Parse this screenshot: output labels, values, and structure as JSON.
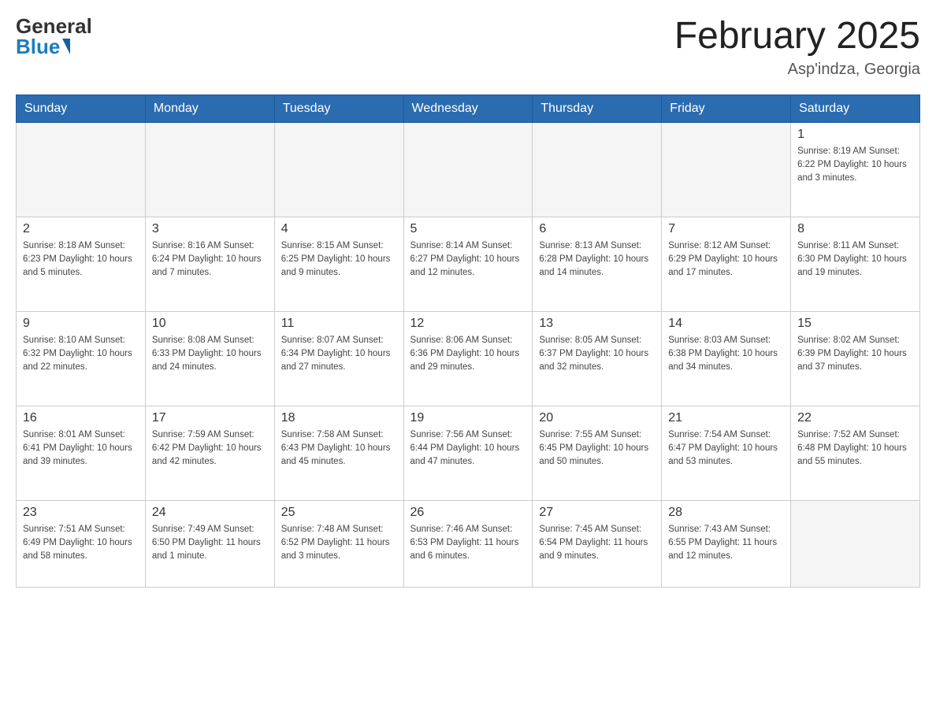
{
  "header": {
    "logo_general": "General",
    "logo_blue": "Blue",
    "month_title": "February 2025",
    "location": "Asp'indza, Georgia"
  },
  "calendar": {
    "days_of_week": [
      "Sunday",
      "Monday",
      "Tuesday",
      "Wednesday",
      "Thursday",
      "Friday",
      "Saturday"
    ],
    "weeks": [
      [
        {
          "day": "",
          "info": "",
          "empty": true
        },
        {
          "day": "",
          "info": "",
          "empty": true
        },
        {
          "day": "",
          "info": "",
          "empty": true
        },
        {
          "day": "",
          "info": "",
          "empty": true
        },
        {
          "day": "",
          "info": "",
          "empty": true
        },
        {
          "day": "",
          "info": "",
          "empty": true
        },
        {
          "day": "1",
          "info": "Sunrise: 8:19 AM\nSunset: 6:22 PM\nDaylight: 10 hours\nand 3 minutes.",
          "empty": false
        }
      ],
      [
        {
          "day": "2",
          "info": "Sunrise: 8:18 AM\nSunset: 6:23 PM\nDaylight: 10 hours\nand 5 minutes.",
          "empty": false
        },
        {
          "day": "3",
          "info": "Sunrise: 8:16 AM\nSunset: 6:24 PM\nDaylight: 10 hours\nand 7 minutes.",
          "empty": false
        },
        {
          "day": "4",
          "info": "Sunrise: 8:15 AM\nSunset: 6:25 PM\nDaylight: 10 hours\nand 9 minutes.",
          "empty": false
        },
        {
          "day": "5",
          "info": "Sunrise: 8:14 AM\nSunset: 6:27 PM\nDaylight: 10 hours\nand 12 minutes.",
          "empty": false
        },
        {
          "day": "6",
          "info": "Sunrise: 8:13 AM\nSunset: 6:28 PM\nDaylight: 10 hours\nand 14 minutes.",
          "empty": false
        },
        {
          "day": "7",
          "info": "Sunrise: 8:12 AM\nSunset: 6:29 PM\nDaylight: 10 hours\nand 17 minutes.",
          "empty": false
        },
        {
          "day": "8",
          "info": "Sunrise: 8:11 AM\nSunset: 6:30 PM\nDaylight: 10 hours\nand 19 minutes.",
          "empty": false
        }
      ],
      [
        {
          "day": "9",
          "info": "Sunrise: 8:10 AM\nSunset: 6:32 PM\nDaylight: 10 hours\nand 22 minutes.",
          "empty": false
        },
        {
          "day": "10",
          "info": "Sunrise: 8:08 AM\nSunset: 6:33 PM\nDaylight: 10 hours\nand 24 minutes.",
          "empty": false
        },
        {
          "day": "11",
          "info": "Sunrise: 8:07 AM\nSunset: 6:34 PM\nDaylight: 10 hours\nand 27 minutes.",
          "empty": false
        },
        {
          "day": "12",
          "info": "Sunrise: 8:06 AM\nSunset: 6:36 PM\nDaylight: 10 hours\nand 29 minutes.",
          "empty": false
        },
        {
          "day": "13",
          "info": "Sunrise: 8:05 AM\nSunset: 6:37 PM\nDaylight: 10 hours\nand 32 minutes.",
          "empty": false
        },
        {
          "day": "14",
          "info": "Sunrise: 8:03 AM\nSunset: 6:38 PM\nDaylight: 10 hours\nand 34 minutes.",
          "empty": false
        },
        {
          "day": "15",
          "info": "Sunrise: 8:02 AM\nSunset: 6:39 PM\nDaylight: 10 hours\nand 37 minutes.",
          "empty": false
        }
      ],
      [
        {
          "day": "16",
          "info": "Sunrise: 8:01 AM\nSunset: 6:41 PM\nDaylight: 10 hours\nand 39 minutes.",
          "empty": false
        },
        {
          "day": "17",
          "info": "Sunrise: 7:59 AM\nSunset: 6:42 PM\nDaylight: 10 hours\nand 42 minutes.",
          "empty": false
        },
        {
          "day": "18",
          "info": "Sunrise: 7:58 AM\nSunset: 6:43 PM\nDaylight: 10 hours\nand 45 minutes.",
          "empty": false
        },
        {
          "day": "19",
          "info": "Sunrise: 7:56 AM\nSunset: 6:44 PM\nDaylight: 10 hours\nand 47 minutes.",
          "empty": false
        },
        {
          "day": "20",
          "info": "Sunrise: 7:55 AM\nSunset: 6:45 PM\nDaylight: 10 hours\nand 50 minutes.",
          "empty": false
        },
        {
          "day": "21",
          "info": "Sunrise: 7:54 AM\nSunset: 6:47 PM\nDaylight: 10 hours\nand 53 minutes.",
          "empty": false
        },
        {
          "day": "22",
          "info": "Sunrise: 7:52 AM\nSunset: 6:48 PM\nDaylight: 10 hours\nand 55 minutes.",
          "empty": false
        }
      ],
      [
        {
          "day": "23",
          "info": "Sunrise: 7:51 AM\nSunset: 6:49 PM\nDaylight: 10 hours\nand 58 minutes.",
          "empty": false
        },
        {
          "day": "24",
          "info": "Sunrise: 7:49 AM\nSunset: 6:50 PM\nDaylight: 11 hours\nand 1 minute.",
          "empty": false
        },
        {
          "day": "25",
          "info": "Sunrise: 7:48 AM\nSunset: 6:52 PM\nDaylight: 11 hours\nand 3 minutes.",
          "empty": false
        },
        {
          "day": "26",
          "info": "Sunrise: 7:46 AM\nSunset: 6:53 PM\nDaylight: 11 hours\nand 6 minutes.",
          "empty": false
        },
        {
          "day": "27",
          "info": "Sunrise: 7:45 AM\nSunset: 6:54 PM\nDaylight: 11 hours\nand 9 minutes.",
          "empty": false
        },
        {
          "day": "28",
          "info": "Sunrise: 7:43 AM\nSunset: 6:55 PM\nDaylight: 11 hours\nand 12 minutes.",
          "empty": false
        },
        {
          "day": "",
          "info": "",
          "empty": true
        }
      ]
    ]
  }
}
